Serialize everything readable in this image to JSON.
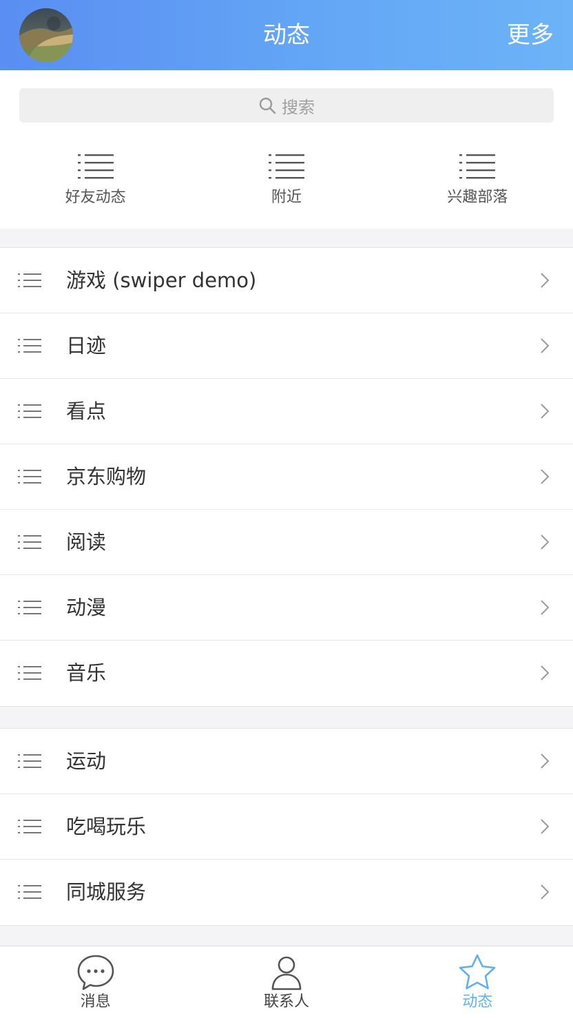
{
  "header": {
    "title": "动态",
    "more_label": "更多",
    "avatar_icon": "user-avatar",
    "gradient_start": "#5a8ef2",
    "gradient_end": "#6cb3f7"
  },
  "search": {
    "placeholder": "搜索",
    "icon": "search-icon"
  },
  "shortcuts": [
    {
      "label": "好友动态",
      "icon": "list-icon"
    },
    {
      "label": "附近",
      "icon": "list-icon"
    },
    {
      "label": "兴趣部落",
      "icon": "list-icon"
    }
  ],
  "list_group_1": [
    {
      "label": "游戏 (swiper demo)"
    },
    {
      "label": "日迹"
    },
    {
      "label": "看点"
    },
    {
      "label": "京东购物"
    },
    {
      "label": "阅读"
    },
    {
      "label": "动漫"
    },
    {
      "label": "音乐"
    }
  ],
  "list_group_2": [
    {
      "label": "运动"
    },
    {
      "label": "吃喝玩乐"
    },
    {
      "label": "同城服务"
    }
  ],
  "tabbar": {
    "active_color": "#5fb0f2",
    "tabs": [
      {
        "label": "消息",
        "icon": "chat-bubble-icon",
        "active": false
      },
      {
        "label": "联系人",
        "icon": "contact-person-icon",
        "active": false
      },
      {
        "label": "动态",
        "icon": "star-icon",
        "active": true
      }
    ]
  }
}
